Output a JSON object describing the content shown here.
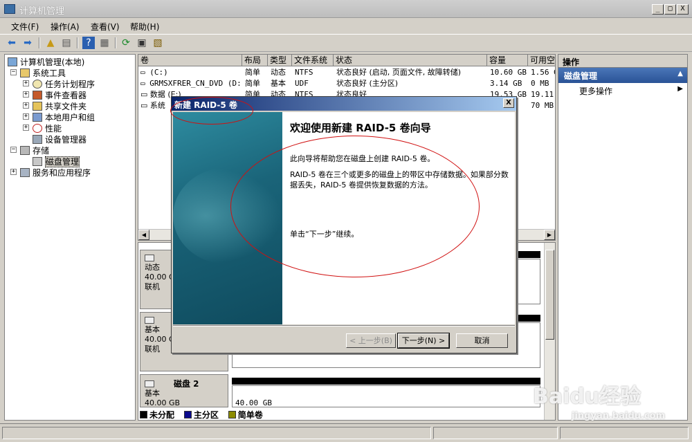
{
  "window": {
    "title": "计算机管理"
  },
  "window_buttons": {
    "minimize": "_",
    "restore": "□",
    "close": "X"
  },
  "menu": [
    "文件(F)",
    "操作(A)",
    "查看(V)",
    "帮助(H)"
  ],
  "tree": {
    "root": "计算机管理(本地)",
    "system_tools": "系统工具",
    "task_scheduler": "任务计划程序",
    "event_viewer": "事件查看器",
    "shared_folders": "共享文件夹",
    "local_users": "本地用户和组",
    "performance": "性能",
    "device_manager": "设备管理器",
    "storage": "存储",
    "disk_management": "磁盘管理",
    "services_apps": "服务和应用程序"
  },
  "volume_list": {
    "columns": [
      "卷",
      "布局",
      "类型",
      "文件系统",
      "状态",
      "容量",
      "可用空"
    ],
    "rows": [
      [
        "(C:)",
        "简单",
        "动态",
        "NTFS",
        "状态良好 (启动, 页面文件, 故障转储)",
        "10.60 GB",
        "1.56 G"
      ],
      [
        "GRMSXFRER_CN_DVD (D:)",
        "简单",
        "基本",
        "UDF",
        "状态良好 (主分区)",
        "3.14 GB",
        "0 MB"
      ],
      [
        "数据 (E:)",
        "简单",
        "动态",
        "NTFS",
        "状态良好",
        "19.53 GB",
        "19.11"
      ],
      [
        "系统",
        "",
        "",
        "",
        "",
        "",
        "70 MB"
      ]
    ]
  },
  "disks": [
    {
      "type": "动态",
      "size": "40.00 GB",
      "status": "联机"
    },
    {
      "type": "基本",
      "size": "40.00 GB",
      "status": "联机"
    },
    {
      "name": "磁盘 2",
      "type": "基本",
      "size": "40.00 GB",
      "partition_size": "40.00 GB"
    }
  ],
  "legend": [
    "未分配",
    "主分区",
    "简单卷"
  ],
  "legend_colors": [
    "#000000",
    "#0a0a8c",
    "#8c8c00"
  ],
  "actions": {
    "header": "操作",
    "section": "磁盘管理",
    "more": "更多操作"
  },
  "dialog": {
    "title": "新建 RAID-5 卷",
    "heading": "欢迎使用新建 RAID-5 卷向导",
    "p1": "此向导将帮助您在磁盘上创建 RAID-5 卷。",
    "p2": "RAID-5 卷在三个或更多的磁盘上的带区中存储数据。如果部分数据丢失，RAID-5 卷提供恢复数据的方法。",
    "p3": "单击“下一步”继续。",
    "back": "< 上一步(B)",
    "next": "下一步(N) >",
    "cancel": "取消",
    "close": "X"
  },
  "watermark": {
    "brand": "Baidu经验",
    "url": "jingyan.baidu.com"
  }
}
